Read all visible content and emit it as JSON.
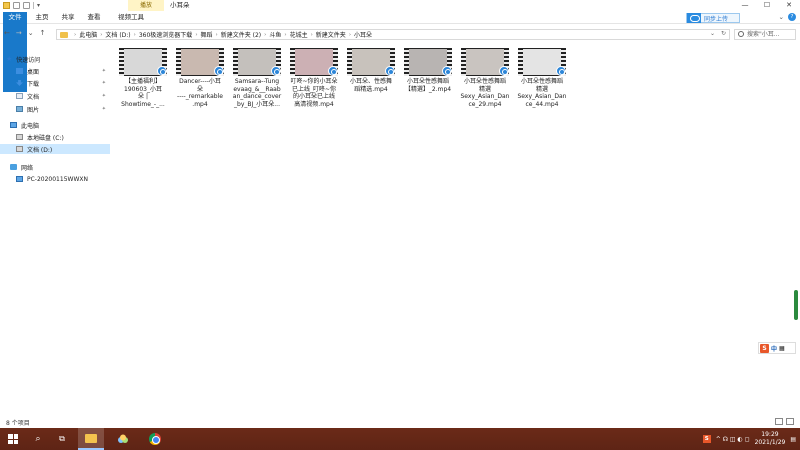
{
  "window": {
    "title": "小耳朵",
    "context_tab": "播放",
    "controls": {
      "minimize": "—",
      "maximize": "☐",
      "close": "✕"
    }
  },
  "ribbon": {
    "tabs": [
      "文件",
      "主页",
      "共享",
      "查看",
      "视频工具"
    ],
    "cloud_button": "同步上传",
    "help": "?"
  },
  "address": {
    "crumbs": [
      "此电脑",
      "文档 (D:)",
      "360极速浏览器下载",
      "舞蹈",
      "新建文件夹 (2)",
      "斗鱼",
      "花城主",
      "新建文件夹",
      "小耳朵"
    ],
    "search_placeholder": "搜索\"小耳..."
  },
  "nav": {
    "quick_access": "快速访问",
    "desktop": "桌面",
    "downloads": "下载",
    "documents": "文档",
    "pictures": "图片",
    "this_pc": "此电脑",
    "local_disk": "本地磁盘 (C:)",
    "doc_drive": "文档 (D:)",
    "network": "网络",
    "pc_name": "PC-20200115WWXN"
  },
  "files": [
    {
      "name": "【主播福利】\n190603_小耳\n朵 | \nShowtime_-_...",
      "thumb": "#d8d8d8"
    },
    {
      "name": "Dancer----小耳\n朵\n----_remarkable\n.mp4",
      "thumb": "#c9b9b0"
    },
    {
      "name": "Samsara--Tung\nevaag_&__Raab\nan_dance_cover\n_by_BJ_小耳朵...",
      "thumb": "#c4c0bc"
    },
    {
      "name": "叮咚~你的小耳朵\n已上线_叮咚~你\n的小耳朵已上线\n高清视频.mp4",
      "thumb": "#ccb0b4"
    },
    {
      "name": "小耳朵、性感舞\n蹈精选.mp4",
      "thumb": "#c8c2bc"
    },
    {
      "name": "小耳朵性感舞蹈\n【精選】_2.mp4",
      "thumb": "#b8b4b2"
    },
    {
      "name": "小耳朵性感舞蹈\n精選\nSexy_Asian_Dan\nce_29.mp4",
      "thumb": "#c9c4c0"
    },
    {
      "name": "小耳朵性感舞蹈\n精選\nSexy_Asian_Dan\nce_44.mp4",
      "thumb": "#e4e4e4"
    }
  ],
  "status": {
    "count": "8 个项目"
  },
  "ime": {
    "zh": "中"
  },
  "taskbar": {
    "time": "19:29",
    "date": "2021/1/29",
    "sogou": "S",
    "tray_icons": "^ ☊ ◫ ◐ ◻"
  }
}
